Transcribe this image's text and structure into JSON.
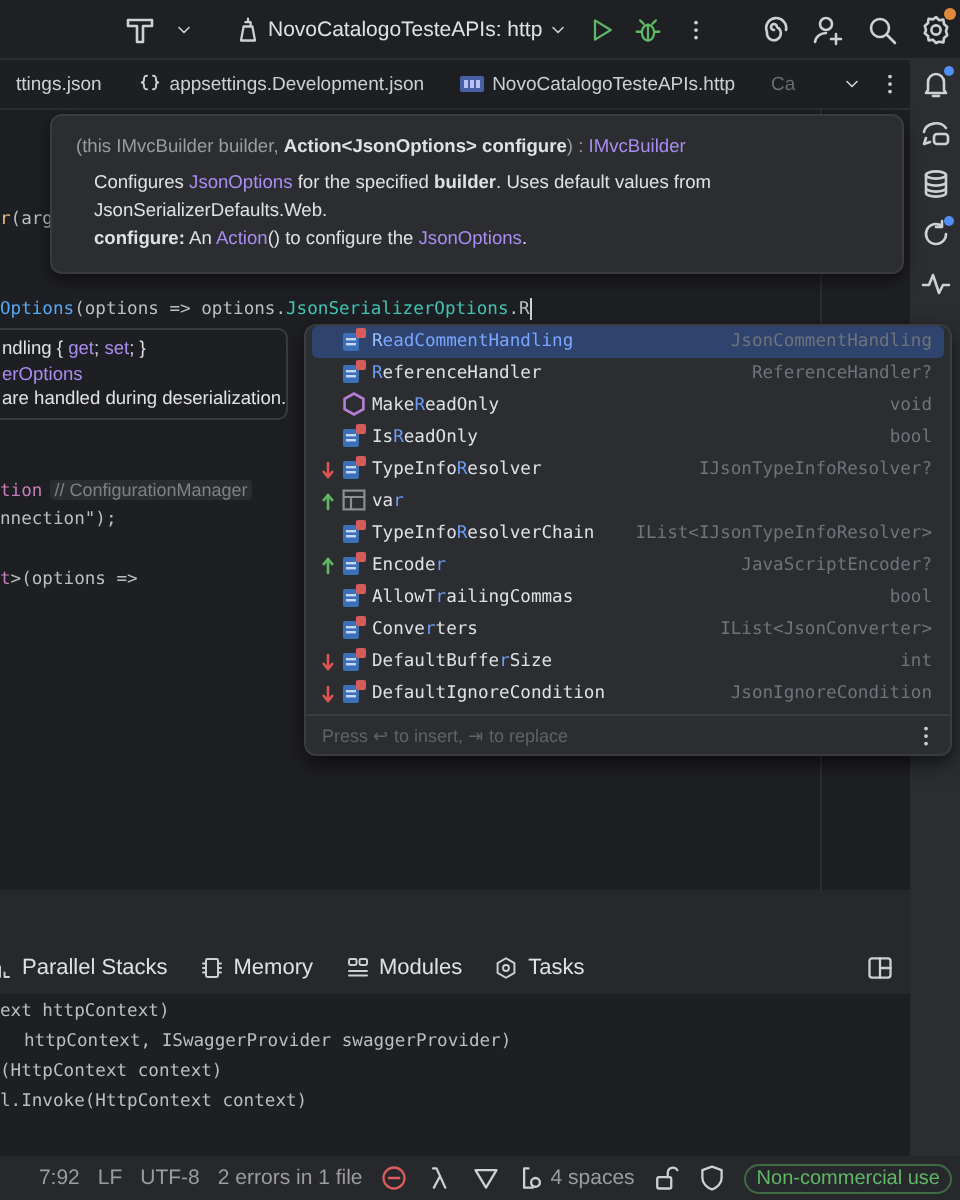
{
  "toolbar": {
    "run_config": "NovoCatalogoTesteAPIs: http"
  },
  "editor_tabs": [
    {
      "label": "ttings.json",
      "kind": "plain"
    },
    {
      "label": "appsettings.Development.json",
      "kind": "json"
    },
    {
      "label": "NovoCatalogoTesteAPIs.http",
      "kind": "api"
    },
    {
      "label": "Ca",
      "kind": "faded"
    }
  ],
  "tooltip": {
    "signature": "(this IMvcBuilder builder, **Action<JsonOptions> configure**) : *IMvcBuilder*",
    "description": "Configures *JsonOptions* for the specified **builder**. Uses default values from JsonSerializerDefaults.Web.",
    "parameter": "**configure:** An *Action*() to configure the *JsonOptions*."
  },
  "code_lines": [
    {
      "tokens": [
        {
          "text": "r",
          "kind": "method"
        },
        {
          "text": "(arg",
          "kind": "plain"
        }
      ]
    },
    {
      "tokens": [
        {
          "text": "Options",
          "kind": "call"
        },
        {
          "text": "(options => options.",
          "kind": "plain"
        },
        {
          "text": "JsonSerializerOptions",
          "kind": "property"
        },
        {
          "text": ".R",
          "kind": "plain"
        }
      ]
    },
    {
      "tokens": [
        {
          "text": "tion",
          "kind": "member"
        },
        {
          "text": "// ConfigurationManager",
          "kind": "hint"
        }
      ]
    },
    {
      "tokens": [
        {
          "text": "nnection\");",
          "kind": "plain"
        }
      ]
    },
    {
      "tokens": [
        {
          "text": "t",
          "kind": "member"
        },
        {
          "text": ">(options =>",
          "kind": "plain"
        }
      ]
    }
  ],
  "doc_popup": [
    {
      "text": "ndling { *get*; *set*; }",
      "kind": "signature"
    },
    {
      "text": "erOptions",
      "kind": "type"
    },
    {
      "text": "are handled during deserialization.",
      "kind": "text"
    }
  ],
  "completion": {
    "items": [
      {
        "name": "**R**eadCommentHandling",
        "type": "JsonCommentHandling",
        "kind": "property",
        "arrow_up": false,
        "arrow_down": false,
        "selected": true
      },
      {
        "name": "**R**eferenceHandler",
        "type": "ReferenceHandler?",
        "kind": "property",
        "arrow_up": false,
        "arrow_down": false,
        "selected": false
      },
      {
        "name": "Make**R**eadOnly",
        "type": "void",
        "kind": "method",
        "arrow_up": false,
        "arrow_down": false,
        "selected": false
      },
      {
        "name": "Is**R**eadOnly",
        "type": "bool",
        "kind": "property",
        "arrow_up": false,
        "arrow_down": false,
        "selected": false
      },
      {
        "name": "TypeInfo**R**esolver",
        "type": "IJsonTypeInfoResolver?",
        "kind": "property",
        "arrow_up": false,
        "arrow_down": true,
        "selected": false
      },
      {
        "name": "va**r**",
        "kind": "variable",
        "arrow_up": true,
        "arrow_down": false,
        "selected": false
      },
      {
        "name": "TypeInfo**R**esolverChain",
        "type": "IList<IJsonTypeInfoResolver>",
        "kind": "property",
        "arrow_up": false,
        "arrow_down": false,
        "selected": false
      },
      {
        "name": "Encode**r**",
        "type": "JavaScriptEncoder?",
        "kind": "property",
        "arrow_up": true,
        "arrow_down": false,
        "selected": false
      },
      {
        "name": "AllowT**r**ailingCommas",
        "type": "bool",
        "kind": "property",
        "arrow_up": false,
        "arrow_down": false,
        "selected": false
      },
      {
        "name": "Conve**r**ters",
        "type": "IList<JsonConverter>",
        "kind": "property",
        "arrow_up": false,
        "arrow_down": false,
        "selected": false
      },
      {
        "name": "DefaultBuffe**r**Size",
        "type": "int",
        "kind": "property",
        "arrow_up": false,
        "arrow_down": true,
        "selected": false
      },
      {
        "name": "DefaultIgnoreCondition",
        "type": "JsonIgnoreCondition",
        "kind": "property",
        "arrow_up": false,
        "arrow_down": true,
        "selected": false
      }
    ],
    "footer": "Press ↩ to insert, ⇥ to replace"
  },
  "panel": {
    "tabs": [
      {
        "label": "Parallel Stacks",
        "kind": "stacks"
      },
      {
        "label": "Memory",
        "kind": "memory"
      },
      {
        "label": "Modules",
        "kind": "modules"
      },
      {
        "label": "Tasks",
        "kind": "tasks"
      }
    ],
    "lines": [
      "ext httpContext)",
      "httpContext, ISwaggerProvider swaggerProvider)",
      "(HttpContext context)",
      "l.Invoke(HttpContext context)"
    ]
  },
  "status_bar": {
    "position": "7:92",
    "line_ending": "LF",
    "encoding": "UTF-8",
    "problems": "2 errors in 1 file",
    "indent": "4 spaces",
    "license": "Non-commercial use"
  }
}
